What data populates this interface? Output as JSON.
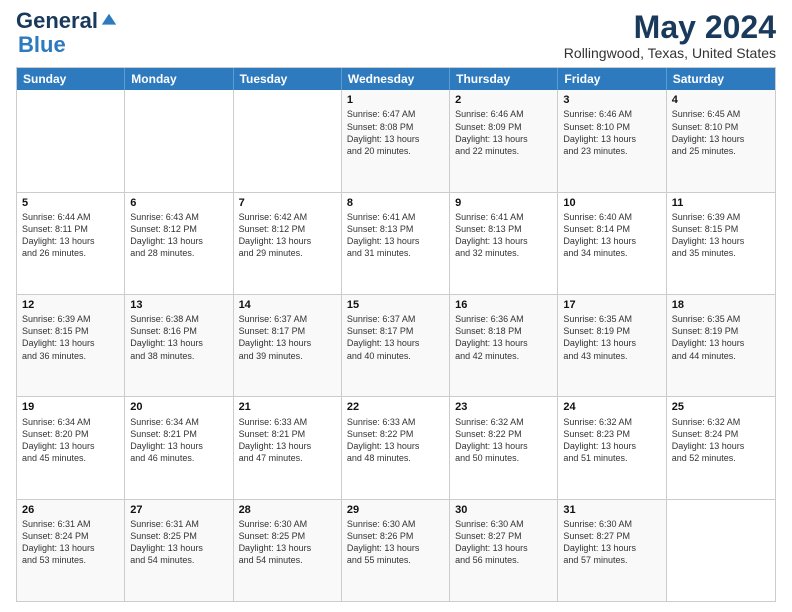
{
  "header": {
    "logo_general": "General",
    "logo_blue": "Blue",
    "title": "May 2024",
    "subtitle": "Rollingwood, Texas, United States"
  },
  "calendar": {
    "days": [
      "Sunday",
      "Monday",
      "Tuesday",
      "Wednesday",
      "Thursday",
      "Friday",
      "Saturday"
    ],
    "rows": [
      [
        {
          "day": "",
          "info": ""
        },
        {
          "day": "",
          "info": ""
        },
        {
          "day": "",
          "info": ""
        },
        {
          "day": "1",
          "info": "Sunrise: 6:47 AM\nSunset: 8:08 PM\nDaylight: 13 hours\nand 20 minutes."
        },
        {
          "day": "2",
          "info": "Sunrise: 6:46 AM\nSunset: 8:09 PM\nDaylight: 13 hours\nand 22 minutes."
        },
        {
          "day": "3",
          "info": "Sunrise: 6:46 AM\nSunset: 8:10 PM\nDaylight: 13 hours\nand 23 minutes."
        },
        {
          "day": "4",
          "info": "Sunrise: 6:45 AM\nSunset: 8:10 PM\nDaylight: 13 hours\nand 25 minutes."
        }
      ],
      [
        {
          "day": "5",
          "info": "Sunrise: 6:44 AM\nSunset: 8:11 PM\nDaylight: 13 hours\nand 26 minutes."
        },
        {
          "day": "6",
          "info": "Sunrise: 6:43 AM\nSunset: 8:12 PM\nDaylight: 13 hours\nand 28 minutes."
        },
        {
          "day": "7",
          "info": "Sunrise: 6:42 AM\nSunset: 8:12 PM\nDaylight: 13 hours\nand 29 minutes."
        },
        {
          "day": "8",
          "info": "Sunrise: 6:41 AM\nSunset: 8:13 PM\nDaylight: 13 hours\nand 31 minutes."
        },
        {
          "day": "9",
          "info": "Sunrise: 6:41 AM\nSunset: 8:13 PM\nDaylight: 13 hours\nand 32 minutes."
        },
        {
          "day": "10",
          "info": "Sunrise: 6:40 AM\nSunset: 8:14 PM\nDaylight: 13 hours\nand 34 minutes."
        },
        {
          "day": "11",
          "info": "Sunrise: 6:39 AM\nSunset: 8:15 PM\nDaylight: 13 hours\nand 35 minutes."
        }
      ],
      [
        {
          "day": "12",
          "info": "Sunrise: 6:39 AM\nSunset: 8:15 PM\nDaylight: 13 hours\nand 36 minutes."
        },
        {
          "day": "13",
          "info": "Sunrise: 6:38 AM\nSunset: 8:16 PM\nDaylight: 13 hours\nand 38 minutes."
        },
        {
          "day": "14",
          "info": "Sunrise: 6:37 AM\nSunset: 8:17 PM\nDaylight: 13 hours\nand 39 minutes."
        },
        {
          "day": "15",
          "info": "Sunrise: 6:37 AM\nSunset: 8:17 PM\nDaylight: 13 hours\nand 40 minutes."
        },
        {
          "day": "16",
          "info": "Sunrise: 6:36 AM\nSunset: 8:18 PM\nDaylight: 13 hours\nand 42 minutes."
        },
        {
          "day": "17",
          "info": "Sunrise: 6:35 AM\nSunset: 8:19 PM\nDaylight: 13 hours\nand 43 minutes."
        },
        {
          "day": "18",
          "info": "Sunrise: 6:35 AM\nSunset: 8:19 PM\nDaylight: 13 hours\nand 44 minutes."
        }
      ],
      [
        {
          "day": "19",
          "info": "Sunrise: 6:34 AM\nSunset: 8:20 PM\nDaylight: 13 hours\nand 45 minutes."
        },
        {
          "day": "20",
          "info": "Sunrise: 6:34 AM\nSunset: 8:21 PM\nDaylight: 13 hours\nand 46 minutes."
        },
        {
          "day": "21",
          "info": "Sunrise: 6:33 AM\nSunset: 8:21 PM\nDaylight: 13 hours\nand 47 minutes."
        },
        {
          "day": "22",
          "info": "Sunrise: 6:33 AM\nSunset: 8:22 PM\nDaylight: 13 hours\nand 48 minutes."
        },
        {
          "day": "23",
          "info": "Sunrise: 6:32 AM\nSunset: 8:22 PM\nDaylight: 13 hours\nand 50 minutes."
        },
        {
          "day": "24",
          "info": "Sunrise: 6:32 AM\nSunset: 8:23 PM\nDaylight: 13 hours\nand 51 minutes."
        },
        {
          "day": "25",
          "info": "Sunrise: 6:32 AM\nSunset: 8:24 PM\nDaylight: 13 hours\nand 52 minutes."
        }
      ],
      [
        {
          "day": "26",
          "info": "Sunrise: 6:31 AM\nSunset: 8:24 PM\nDaylight: 13 hours\nand 53 minutes."
        },
        {
          "day": "27",
          "info": "Sunrise: 6:31 AM\nSunset: 8:25 PM\nDaylight: 13 hours\nand 54 minutes."
        },
        {
          "day": "28",
          "info": "Sunrise: 6:30 AM\nSunset: 8:25 PM\nDaylight: 13 hours\nand 54 minutes."
        },
        {
          "day": "29",
          "info": "Sunrise: 6:30 AM\nSunset: 8:26 PM\nDaylight: 13 hours\nand 55 minutes."
        },
        {
          "day": "30",
          "info": "Sunrise: 6:30 AM\nSunset: 8:27 PM\nDaylight: 13 hours\nand 56 minutes."
        },
        {
          "day": "31",
          "info": "Sunrise: 6:30 AM\nSunset: 8:27 PM\nDaylight: 13 hours\nand 57 minutes."
        },
        {
          "day": "",
          "info": ""
        }
      ]
    ]
  }
}
